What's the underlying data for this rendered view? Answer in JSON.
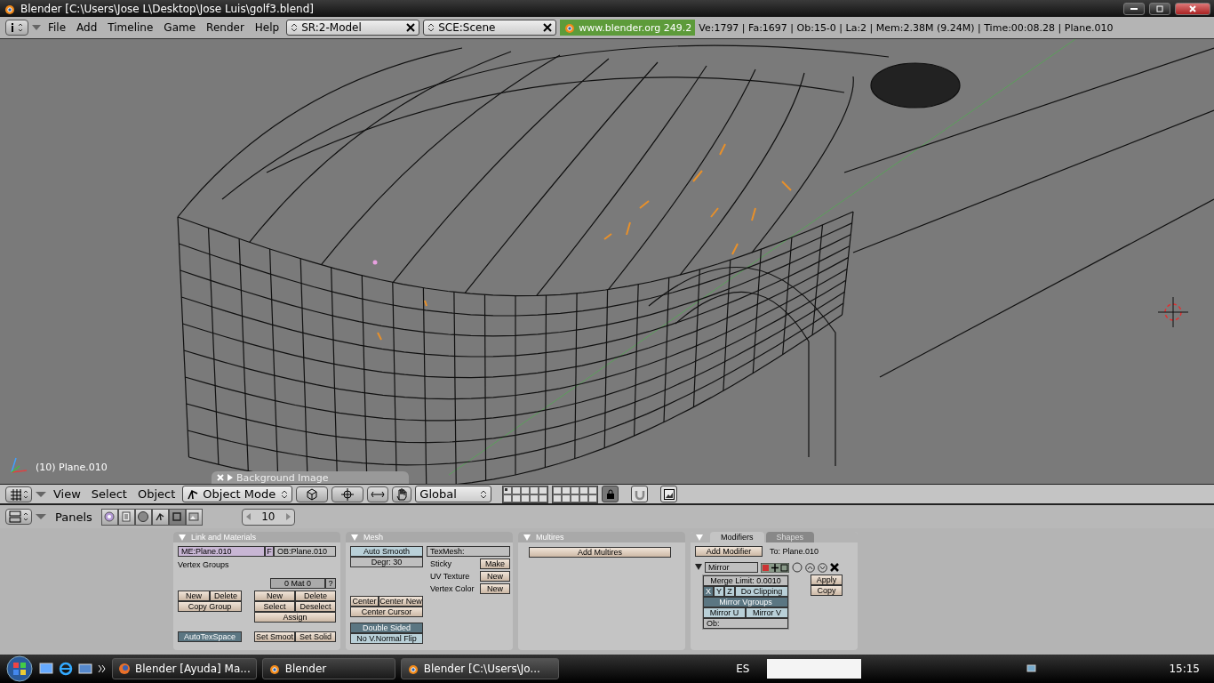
{
  "window": {
    "title": "Blender [C:\\Users\\Jose L\\Desktop\\Jose Luis\\golf3.blend]"
  },
  "top_header": {
    "menus": [
      "File",
      "Add",
      "Timeline",
      "Game",
      "Render",
      "Help"
    ],
    "screen": "SR:2-Model",
    "scene": "SCE:Scene",
    "website": "www.blender.org 249.2",
    "stats": "Ve:1797 | Fa:1697 | Ob:15-0 | La:2 | Mem:2.38M (9.24M) | Time:00:08.28 | Plane.010"
  },
  "viewport": {
    "object_label": "(10) Plane.010",
    "background_image_panel": "Background Image"
  },
  "view3d_header": {
    "menus": [
      "View",
      "Select",
      "Object"
    ],
    "mode": "Object Mode",
    "orientation": "Global",
    "layers": [
      {
        "used": true
      },
      {
        "used": false
      },
      {
        "used": false
      },
      {
        "used": false
      },
      {
        "used": false
      },
      {
        "used": false
      },
      {
        "used": false
      },
      {
        "used": false
      },
      {
        "used": false
      },
      {
        "used": false
      },
      {
        "used": false
      },
      {
        "used": false
      },
      {
        "used": false
      },
      {
        "used": false
      },
      {
        "used": false
      },
      {
        "used": false
      },
      {
        "used": false
      },
      {
        "used": false
      },
      {
        "used": false
      },
      {
        "used": false
      }
    ],
    "lock": {
      "on": true
    }
  },
  "buttons_header": {
    "label": "Panels",
    "context_buttons": [
      {
        "kind": "logic",
        "selected": false
      },
      {
        "kind": "script",
        "selected": false
      },
      {
        "kind": "shading",
        "selected": false
      },
      {
        "kind": "object",
        "selected": false
      },
      {
        "kind": "editing",
        "selected": true
      },
      {
        "kind": "scene",
        "selected": false
      }
    ],
    "frame": "10"
  },
  "link_materials": {
    "title": "Link and Materials",
    "mesh_name": "ME:Plane.010",
    "fake_user": "F",
    "object_name": "OB:Plane.010",
    "vertex_groups_label": "Vertex Groups",
    "material": "0 Mat 0",
    "material_help": "?",
    "vgroup_buttons": [
      "New",
      "Delete",
      "Copy Group"
    ],
    "material_buttons": [
      "New",
      "Delete",
      "Select",
      "Deselect",
      "Assign"
    ],
    "autotexspace": {
      "label": "AutoTexSpace",
      "on": true
    },
    "shading_buttons": [
      "Set Smoot",
      "Set Solid"
    ]
  },
  "mesh": {
    "title": "Mesh",
    "auto_smooth": {
      "label": "Auto Smooth",
      "on": false
    },
    "degree": "Degr: 30",
    "texmesh": "TexMesh:",
    "rows": [
      {
        "label": "Sticky",
        "button": "Make"
      },
      {
        "label": "UV Texture",
        "button": "New"
      },
      {
        "label": "Vertex Color",
        "button": "New"
      }
    ],
    "center_buttons": [
      "Center",
      "Center New",
      "Center Cursor"
    ],
    "double_sided": {
      "label": "Double Sided",
      "on": true
    },
    "no_vnormal_flip": {
      "label": "No V.Normal Flip",
      "on": false
    }
  },
  "multires": {
    "title": "Multires",
    "add_button": "Add Multires"
  },
  "modifiers": {
    "tabs": [
      {
        "label": "Modifiers",
        "selected": true
      },
      {
        "label": "Shapes",
        "selected": false
      }
    ],
    "add_button": "Add Modifier",
    "target": "To: Plane.010",
    "modifier": {
      "name": "Mirror",
      "expanded": true,
      "merge_limit": "Merge Limit: 0.0010",
      "axes": [
        {
          "label": "X",
          "on": true
        },
        {
          "label": "Y",
          "on": false
        },
        {
          "label": "Z",
          "on": false
        }
      ],
      "do_clipping": {
        "label": "Do Clipping",
        "on": false
      },
      "mirror_vgroups": {
        "label": "Mirror Vgroups",
        "on": true
      },
      "mirror_u": {
        "label": "Mirror U",
        "on": false
      },
      "mirror_v": {
        "label": "Mirror V",
        "on": false
      },
      "ob": "Ob:",
      "apply": "Apply",
      "copy": "Copy"
    }
  },
  "taskbar": {
    "items": [
      {
        "label": "Blender [Ayuda] Ma...",
        "kind": "browser",
        "selected": false
      },
      {
        "label": "Blender",
        "kind": "blender",
        "selected": false
      },
      {
        "label": "Blender [C:\\Users\\Jo...",
        "kind": "blender",
        "selected": true
      }
    ],
    "language": "ES",
    "clock": "15:15"
  }
}
